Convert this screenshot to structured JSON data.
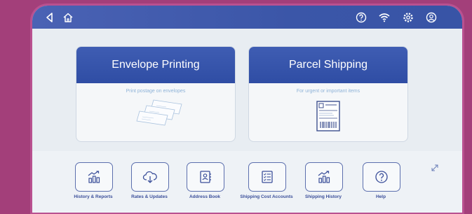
{
  "topbar": {
    "icons": [
      "back-icon",
      "home-icon",
      "help-circle-icon",
      "wifi-icon",
      "settings-icon",
      "account-icon"
    ]
  },
  "cards": [
    {
      "title": "Envelope Printing",
      "subtitle": "Print postage on envelopes",
      "icon": "envelopes-icon"
    },
    {
      "title": "Parcel Shipping",
      "subtitle": "For urgent or important items",
      "icon": "shipping-label-icon"
    }
  ],
  "tiles": [
    {
      "label": "History & Reports",
      "icon": "chart-icon"
    },
    {
      "label": "Rates & Updates",
      "icon": "cloud-download-icon"
    },
    {
      "label": "Address Book",
      "icon": "address-book-icon"
    },
    {
      "label": "Shipping Cost Accounts",
      "icon": "checklist-icon"
    },
    {
      "label": "Shipping History",
      "icon": "chart-icon"
    },
    {
      "label": "Help",
      "icon": "help-icon"
    }
  ],
  "colors": {
    "frame": "#a33f7a",
    "header": "#3b56a8",
    "accent_text": "#3b4f9a",
    "subtitle": "#8fb3d8"
  }
}
